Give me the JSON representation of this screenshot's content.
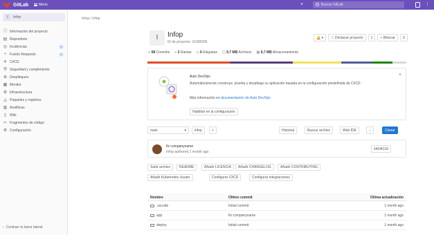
{
  "topbar": {
    "brand": "GitLab",
    "menu_label": "Menú",
    "plus_label": "+",
    "search_placeholder": "Buscar GitLab"
  },
  "sidebar": {
    "project_initial": "I",
    "project_name": "Infop",
    "items": [
      {
        "icon": "info-icon",
        "glyph": "ⓘ",
        "label": "Información del proyecto"
      },
      {
        "icon": "repository-icon",
        "glyph": "▤",
        "label": "Repositorio"
      },
      {
        "icon": "issues-icon",
        "glyph": "◎",
        "label": "Incidencias",
        "badge": "0"
      },
      {
        "icon": "merge-request-icon",
        "glyph": "⑂",
        "label": "Fusión Requests",
        "badge": "0"
      },
      {
        "icon": "rocket-icon",
        "glyph": "✈",
        "label": "CI/CD"
      },
      {
        "icon": "shield-icon",
        "glyph": "⛨",
        "label": "Seguridad y cumplimiento"
      },
      {
        "icon": "deployments-icon",
        "glyph": "⊕",
        "label": "Despliegues"
      },
      {
        "icon": "monitor-icon",
        "glyph": "▦",
        "label": "Monitor"
      },
      {
        "icon": "infrastructure-icon",
        "glyph": "⚙",
        "label": "Infraestructura"
      },
      {
        "icon": "package-icon",
        "glyph": "◬",
        "label": "Paquetes y registros"
      },
      {
        "icon": "analytics-icon",
        "glyph": "▥",
        "label": "Analíticas"
      },
      {
        "icon": "wiki-icon",
        "glyph": "▯",
        "label": "Wiki"
      },
      {
        "icon": "snippets-icon",
        "glyph": "✂",
        "label": "Fragmentos de código"
      },
      {
        "icon": "settings-icon",
        "glyph": "⚙",
        "label": "Configuración"
      }
    ],
    "collapse_label": "Contraer la barra lateral"
  },
  "breadcrumb": "Infop / Infop",
  "project": {
    "initial": "I",
    "title": "Infop",
    "id_text": "ID de proyecto: 31058306",
    "buttons": [
      "Notificaciones",
      "Destacar proyecto",
      "1",
      "Bifurcar",
      "0"
    ]
  },
  "stats": [
    {
      "value": "58",
      "label": "Commits"
    },
    {
      "value": "2",
      "label": "Ramas"
    },
    {
      "value": "0",
      "label": "Etiquetas"
    },
    {
      "value": "9,7 MB",
      "label": "Archivos"
    },
    {
      "value": "9,7 MB",
      "label": "Almacenamiento"
    }
  ],
  "language_colors": [
    "#e34c26",
    "#563d7c",
    "#f1e05a",
    "#4f5d95",
    "#178600",
    "#d9d9d9"
  ],
  "autodevops": {
    "title": "Auto DevOps",
    "description": "Automáticamente construye, prueba y despliega su aplicación basada en la configuración predefinida de CI/CD.",
    "more_prefix": "Más información en ",
    "more_link": "documentación de Auto DevOps",
    "button": "Habilitar en la configuración"
  },
  "branch_bar": {
    "branch": "main",
    "path": "infop",
    "add": "+",
    "right_buttons": [
      "Historial",
      "Buscar archivo",
      "Web IDE",
      "↓",
      "Clonar"
    ]
  },
  "commit": {
    "title": "fix companyname",
    "meta": "Infop authored 1 month ago",
    "sha": "6454f139"
  },
  "chips": [
    "Subir archivo",
    "README",
    "Añadir LICENCIA",
    "Añadir CHANGELOG",
    "Añadir CONTRIBUTING",
    "Añadir Kubernetes cluster",
    "Configurar CI/CD",
    "Configurar Integraciones"
  ],
  "files": {
    "headers": [
      "Nombre",
      "Último commit",
      "Última actualización"
    ],
    "rows": [
      {
        "name": ".vscode",
        "commit": "Initial commit",
        "updated": "1 month ago"
      },
      {
        "name": "app",
        "commit": "fix companyname",
        "updated": "1 month ago"
      },
      {
        "name": "deploy",
        "commit": "Initial commit",
        "updated": "1 month ago"
      }
    ]
  }
}
